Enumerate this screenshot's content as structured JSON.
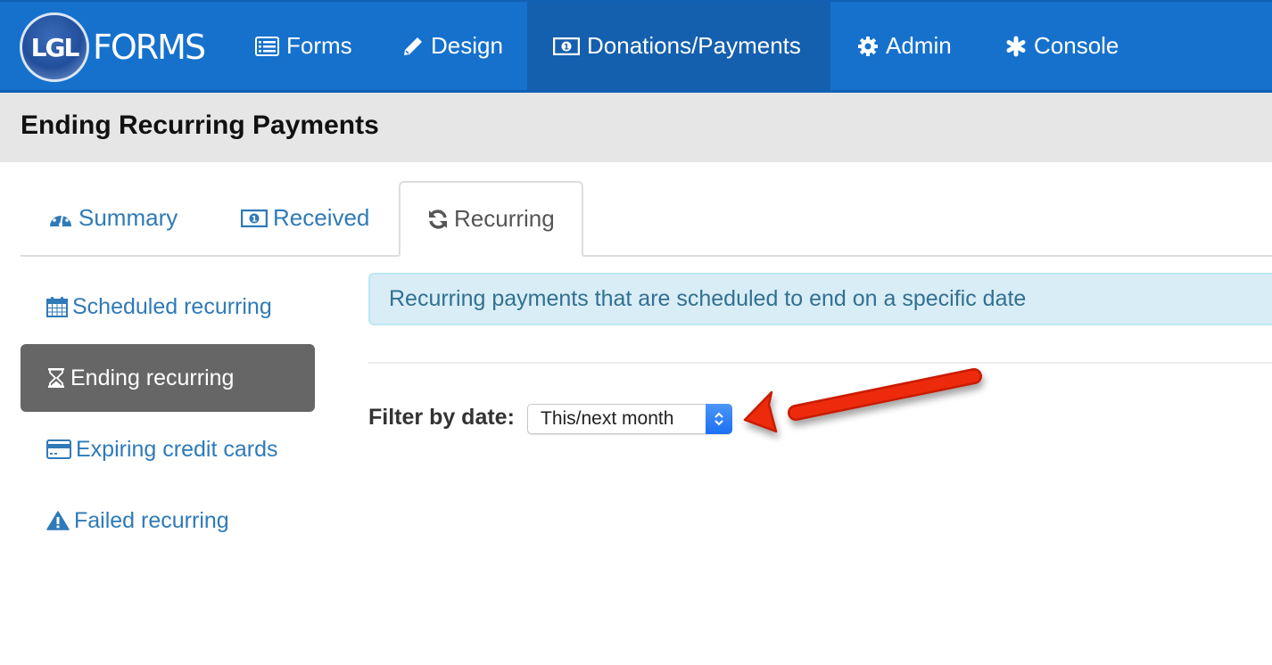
{
  "brand": {
    "logo_mark": "LGL",
    "logo_text": "FORMS",
    "nav_color": "#1671cc",
    "nav_active_color": "#145fae"
  },
  "topnav": {
    "items": [
      {
        "label": "Forms",
        "icon": "list-icon",
        "active": false
      },
      {
        "label": "Design",
        "icon": "pencil-icon",
        "active": false
      },
      {
        "label": "Donations/Payments",
        "icon": "money-icon",
        "active": true
      },
      {
        "label": "Admin",
        "icon": "gear-icon",
        "active": false
      },
      {
        "label": "Console",
        "icon": "asterisk-icon",
        "active": false
      }
    ]
  },
  "page": {
    "title": "Ending Recurring Payments"
  },
  "tabs": [
    {
      "label": "Summary",
      "icon": "dashboard-icon",
      "active": false
    },
    {
      "label": "Received",
      "icon": "money-icon",
      "active": false
    },
    {
      "label": "Recurring",
      "icon": "refresh-icon",
      "active": true
    }
  ],
  "sidenav": {
    "items": [
      {
        "label": "Scheduled recurring",
        "icon": "calendar-icon",
        "active": false
      },
      {
        "label": "Ending recurring",
        "icon": "hourglass-icon",
        "active": true
      },
      {
        "label": "Expiring credit cards",
        "icon": "credit-card-icon",
        "active": false
      },
      {
        "label": "Failed recurring",
        "icon": "warning-icon",
        "active": false
      }
    ]
  },
  "main": {
    "info_text": "Recurring payments that are scheduled to end on a specific date",
    "filter": {
      "label": "Filter by date:",
      "selected": "This/next month"
    },
    "annotation": "red-arrow pointing to filter select"
  }
}
